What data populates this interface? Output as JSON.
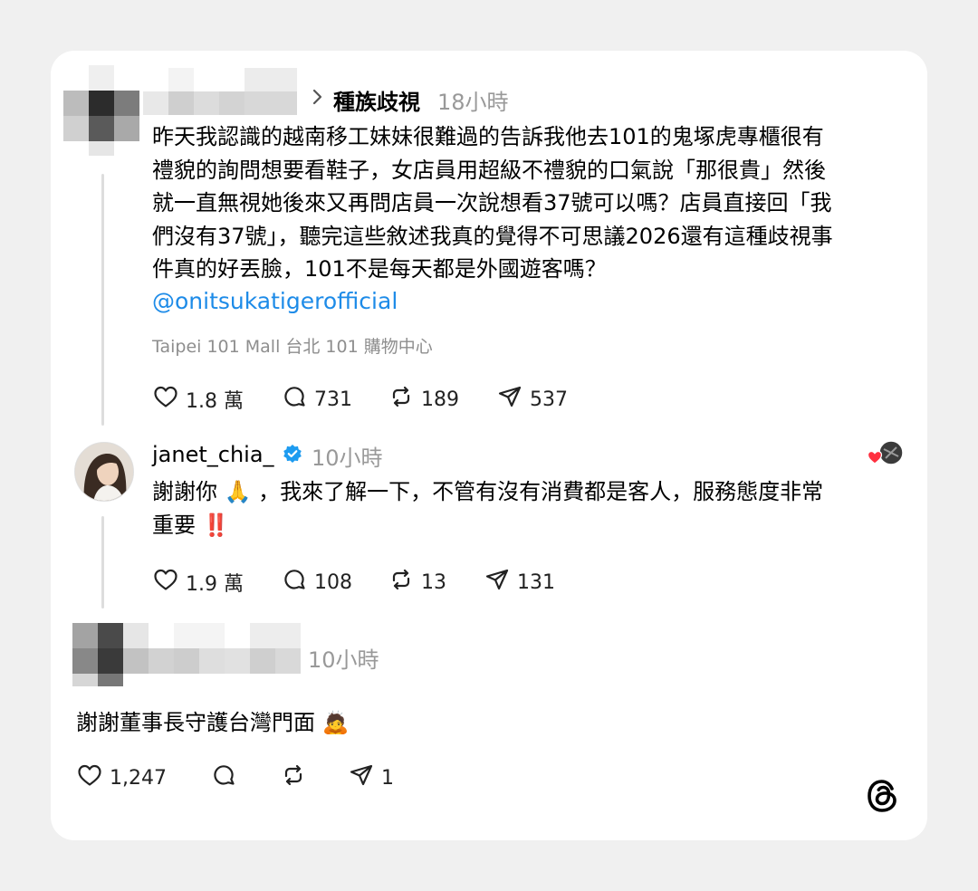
{
  "post1": {
    "reply_to": "種族歧視",
    "time": "18小時",
    "text": "昨天我認識的越南移工妹妹很難過的告訴我他去101的鬼塚虎專櫃很有\n禮貌的詢問想要看鞋子，女店員用超級不禮貌的口氣說「那很貴」然後\n就一直無視她後來又再問店員一次說想看37號可以嗎？店員直接回「我\n們沒有37號」，聽完這些敘述我真的覺得不可思議2026還有這種歧視事\n件真的好丟臉，101不是每天都是外國遊客嗎？",
    "mention": "@onitsukatigerofficial",
    "location": "Taipei 101 Mall 台北 101 購物中心",
    "likes": "1.8 萬",
    "comments": "731",
    "reposts": "189",
    "shares": "537"
  },
  "post2": {
    "username": "janet_chia_",
    "time": "10小時",
    "text": "謝謝你 🙏 ，我來了解一下，不管有沒有消費都是客人，服務態度非常\n重要 ‼️",
    "likes": "1.9 萬",
    "comments": "108",
    "reposts": "13",
    "shares": "131"
  },
  "post3": {
    "time": "10小時",
    "text": "謝謝董事長守護台灣門面 🙇",
    "likes": "1,247",
    "shares": "1"
  },
  "icons": {
    "like": "heart-icon",
    "comment": "comment-bubble-icon",
    "repost": "repost-icon",
    "share": "send-icon",
    "verified": "verified-badge-icon",
    "brand": "threads-logo-icon"
  },
  "colors": {
    "mention": "#1d8be8",
    "verified": "#1d9bf0",
    "secondary_text": "#999999",
    "heart_badge": "#ff3040"
  }
}
